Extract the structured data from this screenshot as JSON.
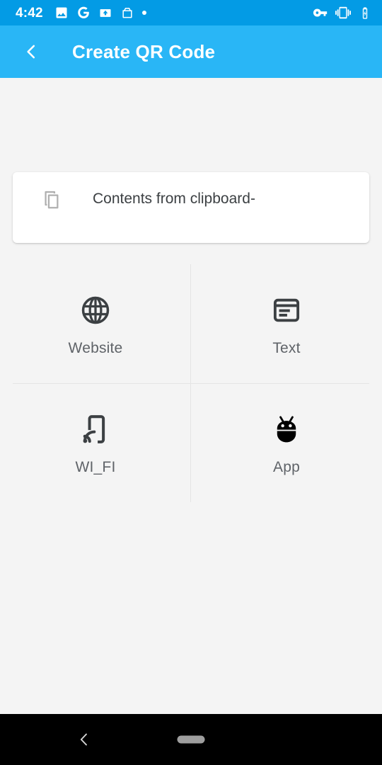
{
  "status_bar": {
    "time": "4:42",
    "background_color": "#039be5",
    "left_icons": [
      {
        "name": "photos-icon"
      },
      {
        "name": "google-icon"
      },
      {
        "name": "drive-backup-icon"
      },
      {
        "name": "package-tracking-icon"
      },
      {
        "name": "notification-dot-icon"
      }
    ],
    "right_icons": [
      {
        "name": "vpn-key-icon"
      },
      {
        "name": "vibrate-icon"
      },
      {
        "name": "battery-charging-icon"
      }
    ]
  },
  "app_bar": {
    "title": "Create QR Code",
    "back_label": "Back",
    "background_color": "#29b6f6",
    "text_color": "#ffffff"
  },
  "clipboard_card": {
    "icon": "content-copy-icon",
    "text": "Contents from clipboard-"
  },
  "grid": {
    "items": [
      {
        "icon": "globe-icon",
        "label": "Website"
      },
      {
        "icon": "article-icon",
        "label": "Text"
      },
      {
        "icon": "wifi-tether-icon",
        "label": "WI_FI"
      },
      {
        "icon": "android-icon",
        "label": "App"
      }
    ],
    "divider_color": "#e4e4e4"
  },
  "nav_bar": {
    "background_color": "#000000",
    "back_label": "Back",
    "home_pill_label": "Home"
  },
  "theme": {
    "page_background": "#f4f4f4",
    "card_background": "#ffffff",
    "primary_text": "#3c4043",
    "secondary_text": "#5f6368",
    "icon_dark": "#3c4043"
  }
}
